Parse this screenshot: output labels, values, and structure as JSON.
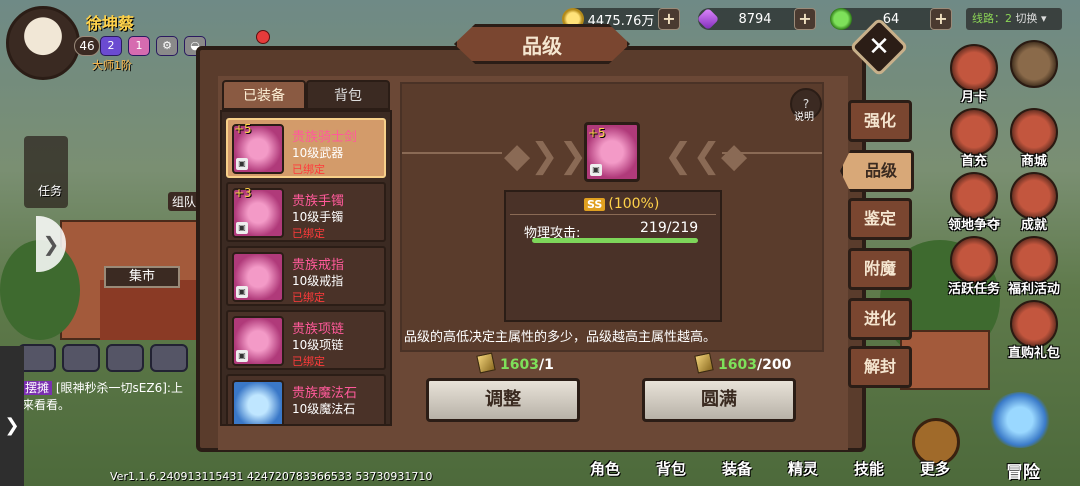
{
  "player": {
    "name": "徐坤蔡",
    "level": "46",
    "badge1": "2",
    "badge2": "1",
    "title": "大师1阶"
  },
  "resources": {
    "coins": "4475.76万",
    "gems": "8794",
    "stamina": "64"
  },
  "server": {
    "line": "线路：2",
    "switch": "切换"
  },
  "dialog": {
    "title": "品级",
    "close": "✕",
    "help_label": "说明",
    "help_icon": "?"
  },
  "list_tabs": {
    "equipped": "已装备",
    "bag": "背包"
  },
  "items": [
    {
      "plus": "+5",
      "name": "贵族骑士剑",
      "level": "10级武器",
      "bind": "已绑定"
    },
    {
      "plus": "+3",
      "name": "贵族手镯",
      "level": "10级手镯",
      "bind": "已绑定"
    },
    {
      "plus": "",
      "name": "贵族戒指",
      "level": "10级戒指",
      "bind": "已绑定"
    },
    {
      "plus": "",
      "name": "贵族项链",
      "level": "10级项链",
      "bind": "已绑定"
    },
    {
      "plus": "",
      "name": "贵族魔法石",
      "level": "10级魔法石",
      "bind": ""
    }
  ],
  "detail": {
    "plus": "+5",
    "grade_tag": "SS",
    "grade_pct": "(100%)",
    "stat_label": "物理攻击:",
    "stat_value": "219/219",
    "stat_fill": 1.0,
    "description": "品级的高低决定主属性的多少，品级越高主属性越高。"
  },
  "costs": {
    "adjust_have": "1603",
    "adjust_need": "/1",
    "perfect_have": "1603",
    "perfect_need": "/200"
  },
  "buttons": {
    "adjust": "调整",
    "perfect": "圆满"
  },
  "side_tabs": [
    "强化",
    "品级",
    "鉴定",
    "附魔",
    "进化",
    "解封"
  ],
  "right_menu": [
    "月卡",
    "首充",
    "商城",
    "领地争夺",
    "成就",
    "活跃任务",
    "福利活动",
    "直购礼包"
  ],
  "left_hud": {
    "task": "任务",
    "team": "组队",
    "market": "集市",
    "arrow": "❯",
    "strip_arrow": "❯"
  },
  "chat": {
    "tag": "摆摊",
    "text": "[眼神秒杀一切sEZ6]:上",
    "text2": "来看看。"
  },
  "version": "Ver1.1.6.240913115431   424720783366533   53730931710",
  "bottom_nav": [
    "角色",
    "背包",
    "装备",
    "精灵",
    "技能",
    "更多",
    "冒险"
  ]
}
